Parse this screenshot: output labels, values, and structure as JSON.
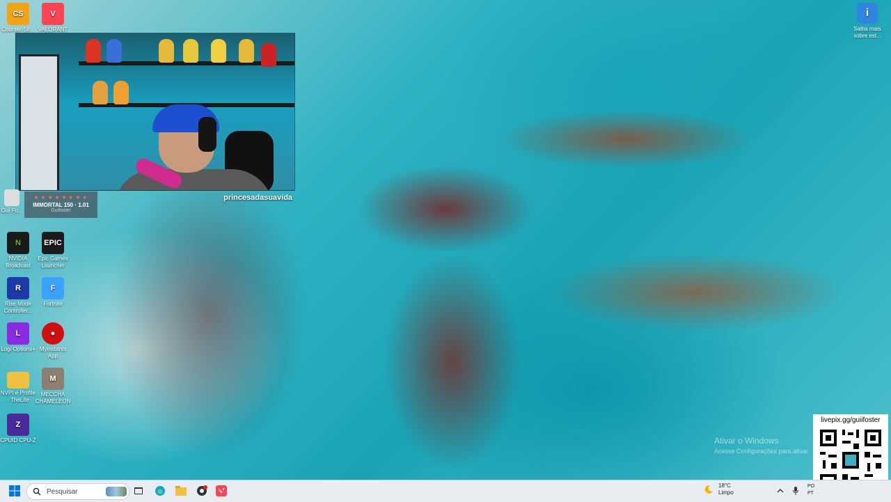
{
  "desktop": {
    "icons_left": [
      {
        "label": "Counter-Str...",
        "short": "CS",
        "color": "#f2a316"
      },
      {
        "label": "VALORANT",
        "short": "V",
        "color": "#fa4454"
      },
      {
        "label": "NVIDIA Broadcast",
        "short": "N",
        "color": "#76b900"
      },
      {
        "label": "Epic Games Launcher",
        "short": "EPIC",
        "color": "#1b1b1b"
      },
      {
        "label": "Rise Mode Controller...",
        "short": "R",
        "color": "#1d3aa8"
      },
      {
        "label": "Fortnite",
        "short": "F",
        "color": "#3aa3ff"
      },
      {
        "label": "Logi Options+",
        "short": "L",
        "color": "#8a2be2"
      },
      {
        "label": "Myinstants App",
        "short": "●",
        "color": "#d01010"
      },
      {
        "label": "NVPI e Profile - TheLite",
        "short": "▬",
        "color": "#f0c040"
      },
      {
        "label": "MECCHA CHAMELEON",
        "short": "M",
        "color": "#8c7f70"
      },
      {
        "label": "CPUID CPU-Z",
        "short": "Z",
        "color": "#4a2a9a"
      }
    ],
    "info_icon": {
      "label": "Saiba mais sobre est..."
    }
  },
  "webcam": {
    "caption": "princesadasuavida",
    "rank": "IMMORTAL 150 · 1.01",
    "rank_sub": "Guifoster",
    "rank_left_label": "Gui Fo..."
  },
  "watermark": {
    "line1": "Ativar o Windows",
    "line2": "Acesse Configurações para ativar"
  },
  "qr": {
    "url": "livepix.gg/guiifoster"
  },
  "taskbar": {
    "search_placeholder": "Pesquisar",
    "weather_temp": "18°C",
    "weather_desc": "Limpo",
    "tray_line1": "PO",
    "tray_line2": "PT"
  },
  "icons": {
    "start": "windows-start-icon",
    "search": "search-icon",
    "task_view": "task-view-icon",
    "edge": "edge-icon",
    "explorer": "file-explorer-icon",
    "obs": "obs-icon",
    "valorant": "valorant-taskbar-icon",
    "weather": "moon-icon",
    "chevron": "chevron-up-icon",
    "mic": "microphone-icon"
  }
}
